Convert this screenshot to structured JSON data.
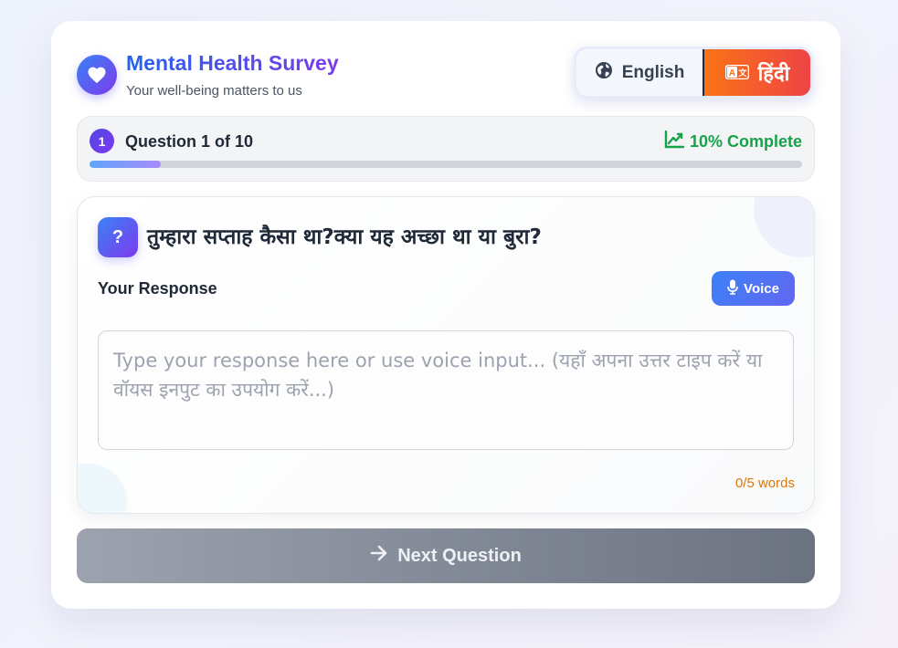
{
  "header": {
    "title": "Mental Health Survey",
    "subtitle": "Your well-being matters to us",
    "logo_icon": "heart-icon"
  },
  "language": {
    "english_label": "English",
    "hindi_label": "हिंदी",
    "english_icon": "globe-icon",
    "hindi_icon": "translate-icon",
    "selected": "hindi"
  },
  "progress": {
    "question_number": "1",
    "counter_label": "Question 1 of 10",
    "complete_label": "10% Complete",
    "percent": 10,
    "icon": "chart-line-icon"
  },
  "question": {
    "icon_label": "?",
    "text": "तुम्हारा सप्ताह कैसा था?क्या यह अच्छा था या बुरा?",
    "response_label": "Your Response",
    "voice_label": "Voice",
    "voice_icon": "microphone-icon",
    "input_placeholder": "Type your response here or use voice input... (यहाँ अपना उत्तर टाइप करें या वॉयस इनपुट का उपयोग करें...)",
    "input_value": "",
    "word_count": "0/5 words"
  },
  "footer": {
    "next_label": "Next Question",
    "next_icon": "arrow-right-icon"
  },
  "colors": {
    "accent_blue": "#3b82f6",
    "accent_purple": "#7c3aed",
    "hindi_orange": "#f97316",
    "hindi_red": "#ef4444",
    "complete_green": "#16a34a",
    "word_count_amber": "#d97706"
  }
}
